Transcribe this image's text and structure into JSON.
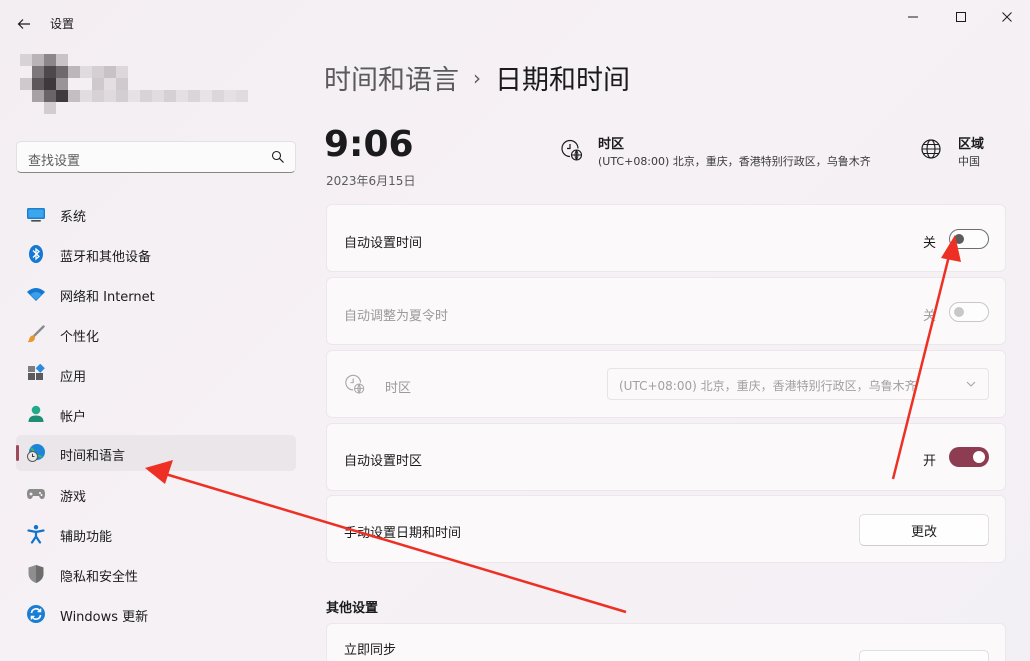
{
  "app": {
    "title": "设置"
  },
  "search": {
    "placeholder": "查找设置"
  },
  "sidebar": {
    "items": [
      {
        "label": "系统",
        "icon": "monitor-icon"
      },
      {
        "label": "蓝牙和其他设备",
        "icon": "bluetooth-icon"
      },
      {
        "label": "网络和 Internet",
        "icon": "wifi-icon"
      },
      {
        "label": "个性化",
        "icon": "brush-icon"
      },
      {
        "label": "应用",
        "icon": "apps-icon"
      },
      {
        "label": "帐户",
        "icon": "account-icon"
      },
      {
        "label": "时间和语言",
        "icon": "globe-clock-icon",
        "active": true
      },
      {
        "label": "游戏",
        "icon": "gamepad-icon"
      },
      {
        "label": "辅助功能",
        "icon": "accessibility-icon"
      },
      {
        "label": "隐私和安全性",
        "icon": "shield-icon"
      },
      {
        "label": "Windows 更新",
        "icon": "update-icon"
      }
    ]
  },
  "breadcrumb": {
    "parent": "时间和语言",
    "separator": "›",
    "current": "日期和时间"
  },
  "clock": {
    "time": "9:06",
    "date": "2023年6月15日"
  },
  "timezone_info": {
    "title": "时区",
    "value": "(UTC+08:00) 北京，重庆，香港特别行政区，乌鲁木齐"
  },
  "region_info": {
    "title": "区域",
    "value": "中国"
  },
  "settings": {
    "auto_time": {
      "label": "自动设置时间",
      "state": "关",
      "on": false
    },
    "auto_dst": {
      "label": "自动调整为夏令时",
      "state": "关",
      "on": false,
      "disabled": true
    },
    "timezone": {
      "label": "时区",
      "value": "(UTC+08:00) 北京，重庆，香港特别行政区，乌鲁木齐",
      "disabled": true
    },
    "auto_timezone": {
      "label": "自动设置时区",
      "state": "开",
      "on": true
    },
    "manual": {
      "label": "手动设置日期和时间",
      "button": "更改"
    }
  },
  "other": {
    "title": "其他设置",
    "sync": {
      "label": "立即同步"
    }
  },
  "colors": {
    "accent": "#8e3c52",
    "annotation_arrow": "#ee3024"
  }
}
